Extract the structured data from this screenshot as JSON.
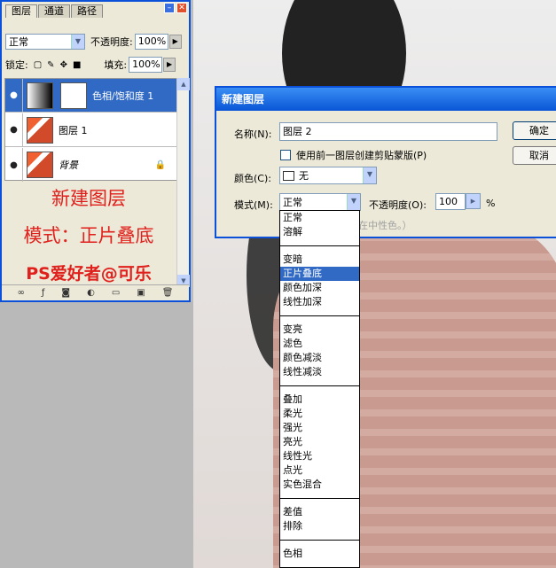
{
  "layers_panel": {
    "tabs": [
      "图层",
      "通道",
      "路径"
    ],
    "blend_mode": "正常",
    "opacity_label": "不透明度:",
    "opacity_value": "100%",
    "lock_label": "锁定:",
    "fill_label": "填充:",
    "fill_value": "100%",
    "layers": [
      {
        "name": "色相/饱和度 1",
        "selected": true
      },
      {
        "name": "图层 1",
        "selected": false
      },
      {
        "name": "背景",
        "selected": false
      }
    ],
    "caption_1": "新建图层",
    "caption_2": "模式：正片叠底",
    "caption_3": "PS爱好者@可乐"
  },
  "dialog": {
    "title": "新建图层",
    "name_label": "名称(N):",
    "name_value": "图层 2",
    "ok_button": "确定",
    "cancel_button": "取消",
    "clip_checkbox_label": "使用前一图层创建剪贴蒙版(P)",
    "color_label": "颜色(C):",
    "color_value": "无",
    "mode_label": "模式(M):",
    "mode_value": "正常",
    "opacity_label": "不透明度(O):",
    "opacity_value": "100",
    "percent": "%",
    "hidden_hint": "在中性色。）"
  },
  "mode_options": [
    [
      "正常",
      "溶解"
    ],
    [
      "变暗",
      "正片叠底",
      "颜色加深",
      "线性加深"
    ],
    [
      "变亮",
      "滤色",
      "颜色减淡",
      "线性减淡"
    ],
    [
      "叠加",
      "柔光",
      "强光",
      "亮光",
      "线性光",
      "点光",
      "实色混合"
    ],
    [
      "差值",
      "排除"
    ],
    [
      "色相"
    ]
  ],
  "highlighted_option": "正片叠底",
  "colors": {
    "selection": "#316ac5",
    "caption": "#e0201c",
    "titlebar": "#0a55d6"
  }
}
